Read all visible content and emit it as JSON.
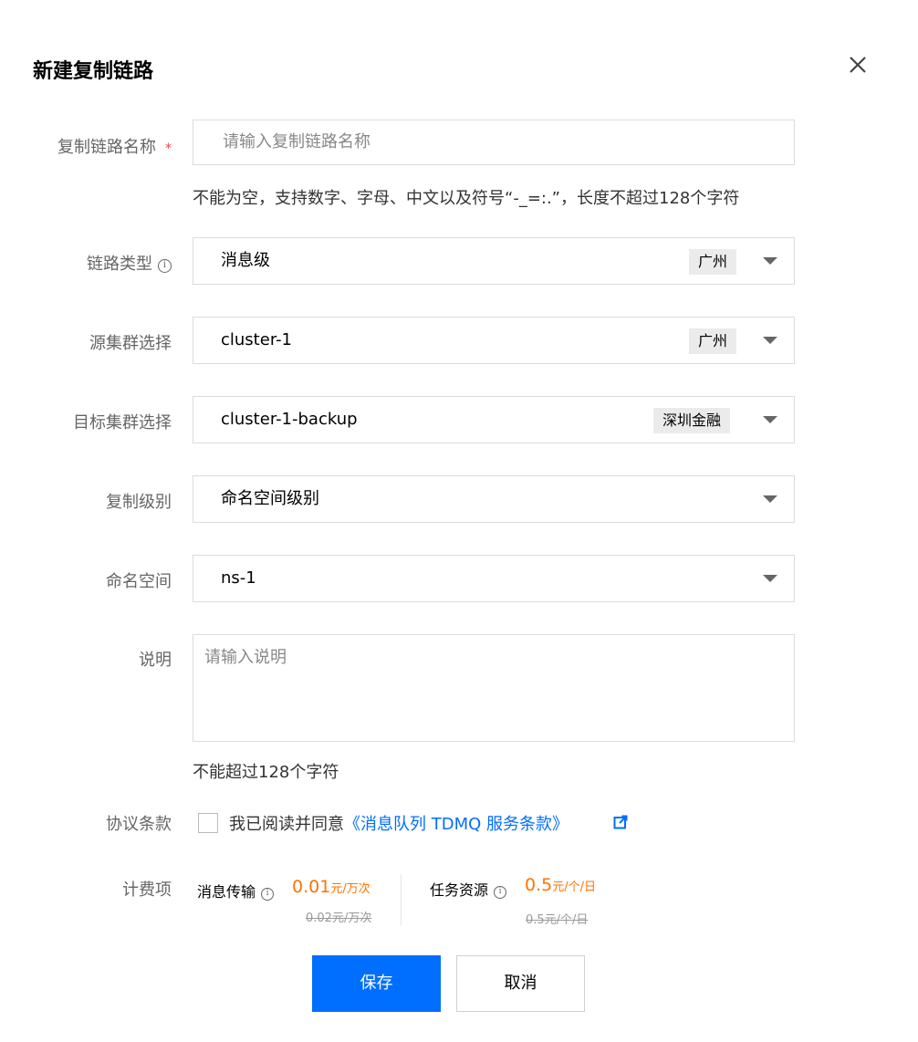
{
  "dialog": {
    "title": "新建复制链路"
  },
  "form": {
    "name": {
      "label": "复制链路名称",
      "required_mark": "*",
      "placeholder": "请输入复制链路名称",
      "hint": "不能为空，支持数字、字母、中文以及符号“-_=:.”，长度不超过128个字符"
    },
    "link_type": {
      "label": "链路类型",
      "info_icon": "ⓘ",
      "value": "消息级",
      "region": "广州"
    },
    "source_cluster": {
      "label": "源集群选择",
      "value": "cluster-1",
      "region": "广州"
    },
    "target_cluster": {
      "label": "目标集群选择",
      "value": "cluster-1-backup",
      "region": "深圳金融"
    },
    "replication_level": {
      "label": "复制级别",
      "value": "命名空间级别"
    },
    "namespace": {
      "label": "命名空间",
      "value": "ns-1"
    },
    "description": {
      "label": "说明",
      "placeholder": "请输入说明",
      "hint": "不能超过128个字符"
    },
    "agreement": {
      "label": "协议条款",
      "checked": false,
      "text": "我已阅读并同意",
      "link_text": "《消息队列 TDMQ 服务条款》"
    },
    "billing": {
      "label": "计费项",
      "items": [
        {
          "name": "消息传输",
          "price": "0.01",
          "unit": "元/万次",
          "original": "0.02元/万次"
        },
        {
          "name": "任务资源",
          "price": "0.5",
          "unit": "元/个/日",
          "original": "0.5元/个/日"
        }
      ]
    }
  },
  "actions": {
    "save_label": "保存",
    "cancel_label": "取消"
  },
  "colors": {
    "primary": "#006eff",
    "price": "#ff7200",
    "required": "#e54545"
  }
}
